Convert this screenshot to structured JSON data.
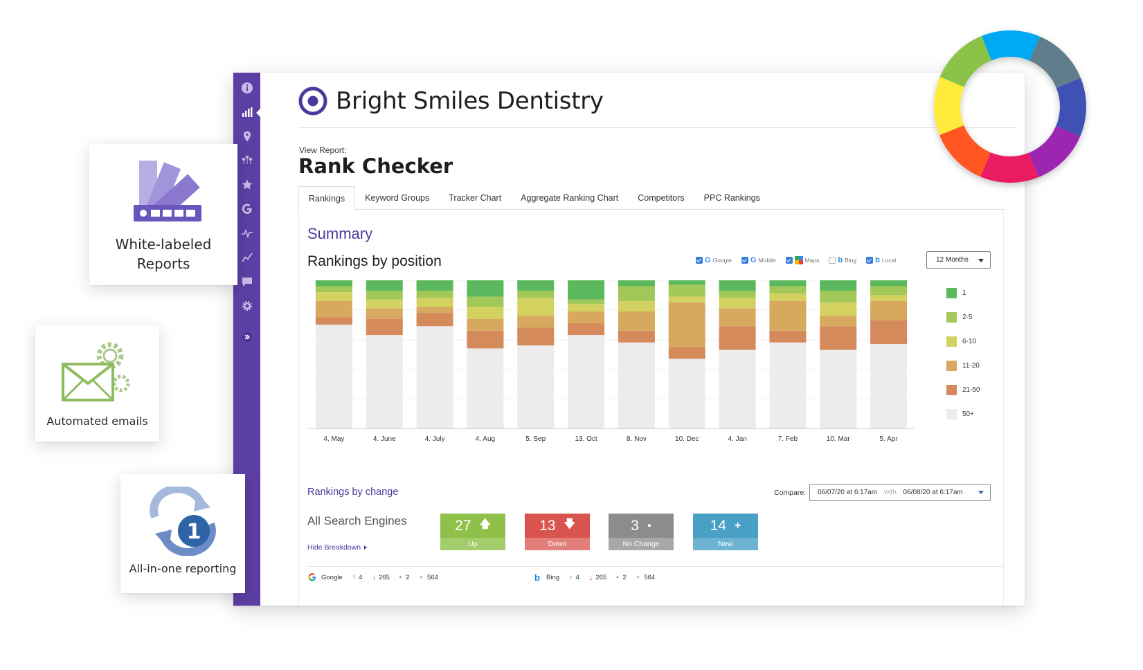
{
  "brand": {
    "name": "Bright Smiles Dentistry"
  },
  "report": {
    "view_label": "View Report:",
    "title": "Rank Checker"
  },
  "tabs": [
    "Rankings",
    "Keyword Groups",
    "Tracker Chart",
    "Aggregate Ranking Chart",
    "Competitors",
    "PPC Rankings"
  ],
  "summary": {
    "title": "Summary",
    "rankings_by_position_title": "Rankings by position",
    "engines": [
      {
        "label": "Google",
        "checked": true,
        "icon": "google-icon"
      },
      {
        "label": "Mobile",
        "checked": true,
        "icon": "google-icon"
      },
      {
        "label": "Maps",
        "checked": true,
        "icon": "maps-icon"
      },
      {
        "label": "Bing",
        "checked": false,
        "icon": "bing-icon"
      },
      {
        "label": "Local",
        "checked": true,
        "icon": "bing-icon"
      }
    ],
    "period": "12 Months"
  },
  "chart_data": {
    "type": "bar",
    "stacked": true,
    "categories": [
      "4. May",
      "4. June",
      "4. July",
      "4. Aug",
      "5. Sep",
      "13. Oct",
      "8. Nov",
      "10. Dec",
      "4. Jan",
      "7. Feb",
      "10. Mar",
      "5. Apr"
    ],
    "series": [
      {
        "name": "1",
        "color": "#5cb85c",
        "values": [
          4,
          7,
          7,
          11,
          7,
          13,
          4,
          3,
          7,
          4,
          7,
          4
        ]
      },
      {
        "name": "2-5",
        "color": "#a3c85a",
        "values": [
          4,
          6,
          5,
          7,
          5,
          3,
          10,
          8,
          5,
          5,
          8,
          6
        ]
      },
      {
        "name": "6-10",
        "color": "#d3d15f",
        "values": [
          6,
          6,
          6,
          8,
          12,
          5,
          7,
          4,
          7,
          5,
          9,
          4
        ]
      },
      {
        "name": "11-20",
        "color": "#d6a95e",
        "values": [
          11,
          7,
          4,
          8,
          8,
          8,
          13,
          30,
          12,
          20,
          7,
          13
        ]
      },
      {
        "name": "21-50",
        "color": "#d58a5c",
        "values": [
          5,
          11,
          9,
          12,
          12,
          8,
          8,
          8,
          16,
          8,
          16,
          16
        ]
      },
      {
        "name": "50+",
        "color": "#ececec",
        "values": [
          70,
          63,
          69,
          54,
          56,
          63,
          58,
          47,
          53,
          58,
          53,
          57
        ]
      }
    ],
    "ylim": [
      0,
      100
    ]
  },
  "legend": [
    {
      "label": "1",
      "color": "#5cb85c"
    },
    {
      "label": "2-5",
      "color": "#a3c85a"
    },
    {
      "label": "6-10",
      "color": "#d3d15f"
    },
    {
      "label": "11-20",
      "color": "#d6a95e"
    },
    {
      "label": "21-50",
      "color": "#d58a5c"
    },
    {
      "label": "50+",
      "color": "#ececec"
    }
  ],
  "change": {
    "title": "Rankings by change",
    "compare_label": "Compare:",
    "compare_from": "06/07/20 at 6:17am",
    "compare_with": "with",
    "compare_to": "06/08/20 at 6:17am",
    "all_engines_label": "All Search Engines",
    "hide_breakdown": "Hide Breakdown",
    "up": {
      "value": "27",
      "label": "Up"
    },
    "down": {
      "value": "13",
      "label": "Down"
    },
    "no_change": {
      "value": "3",
      "label": "No Change"
    },
    "new": {
      "value": "14",
      "label": "New"
    }
  },
  "breakdown": [
    {
      "engine": "Google",
      "up": "4",
      "down": "265",
      "same": "2",
      "new": "564"
    },
    {
      "engine": "Bing",
      "up": "4",
      "down": "265",
      "same": "2",
      "new": "564"
    }
  ],
  "cards": {
    "white_label": "White-labeled Reports",
    "emails": "Automated emails",
    "all_in_one": "All-in-one reporting",
    "all_in_one_badge": "1"
  },
  "colors": {
    "sidebar": "#5c3fa3",
    "accent": "#4b3a9c"
  }
}
